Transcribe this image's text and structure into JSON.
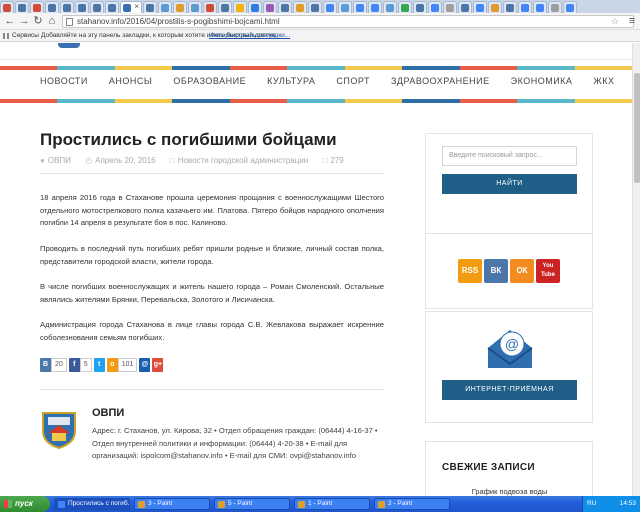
{
  "browser": {
    "tab_favicons": [
      "#d24b36",
      "#4a76a8",
      "#d24b36",
      "#4a76a8",
      "#4a76a8",
      "#4a76a8",
      "#4a76a8",
      "#4a76a8"
    ],
    "active_tab_close": "×",
    "right_tab_favicons": [
      "#4a76a8",
      "#5b9bd5",
      "#e09a2b",
      "#5b9bd5",
      "#d24b36",
      "#4a76a8",
      "#f4b400",
      "#2a7de1",
      "#9b59b6",
      "#4a76a8",
      "#e09a2b",
      "#4a76a8",
      "#4285f4",
      "#5b9bd5",
      "#4285f4",
      "#4285f4",
      "#5b9bd5",
      "#34a853",
      "#4a76a8",
      "#4285f4",
      "#9e9e9e",
      "#4a76a8",
      "#4285f4",
      "#e09a2b",
      "#4a76a8",
      "#4285f4",
      "#4285f4",
      "#9e9e9e",
      "#4285f4"
    ],
    "url": "stahanov.info/2016/04/prostilis-s-pogibshimi-bojcami.html",
    "bookmarks": {
      "services": "Сервисы",
      "hint": "Добавляйте на эту панель закладки, к которым хотите иметь быстрый доступ.",
      "import": "Импортировать закладки..."
    }
  },
  "nav": {
    "items": [
      "НОВОСТИ",
      "АНОНСЫ",
      "ОБРАЗОВАНИЕ",
      "КУЛЬТУРА",
      "СПОРТ",
      "ЗДРАВООХРАНЕНИЕ",
      "ЭКОНОМИКА",
      "ЖКХ"
    ]
  },
  "colors": {
    "stripe": [
      "#e85c4a",
      "#5bb8c9",
      "#f2c94c",
      "#2f6fa6",
      "#e85c4a",
      "#5bb8c9",
      "#f2c94c",
      "#2f6fa6",
      "#e85c4a",
      "#5bb8c9",
      "#f2c94c"
    ],
    "accent": "#1f5e86"
  },
  "article": {
    "title": "Простились с погибшими бойцами",
    "author": "ОВПИ",
    "date": "Апрель 20, 2016",
    "category": "Новости городской администрации",
    "views": "279",
    "paragraphs": [
      "18 апреля 2016 года в Стаханове прошла церемония прощания с военнослужащими Шестого отдельного мотострелкового полка казачьего им. Платова. Пятеро бойцов народного ополчения погибли 14 апреля в результате боя в пос. Калиново.",
      "Проводить в последний путь погибших ребят пришли родные и близкие, личный состав полка, представители городской власти, жители города.",
      "В числе погибших военнослужащих и житель нашего города – Роман Смоленский. Остальные являлись жителями Брянки, Перевальска, Золотого и Лисичанска.",
      "Администрация города Стаханова в лице главы города С.В. Жевлакова выражает искренние соболезнования семьям погибших."
    ],
    "share": [
      {
        "icon": "vk",
        "glyph": "В",
        "count": "20",
        "color": "#4a76a8"
      },
      {
        "icon": "facebook",
        "glyph": "f",
        "count": "5",
        "color": "#3b5998"
      },
      {
        "icon": "twitter",
        "glyph": "t",
        "count": "",
        "color": "#1da1f2"
      },
      {
        "icon": "odnoklassniki",
        "glyph": "о",
        "count": "101",
        "color": "#f39c12"
      },
      {
        "icon": "mail",
        "glyph": "@",
        "count": "",
        "color": "#1a5db0"
      },
      {
        "icon": "google-plus",
        "glyph": "g+",
        "count": "",
        "color": "#dd4b39"
      }
    ]
  },
  "author_box": {
    "name": "ОВПИ",
    "info": "Адрес: г. Стаханов, ул. Кирова, 32 • Отдел обращения граждан: (06444) 4-16-37 • Отдел внутренней политики и информации: (06444) 4-20-38 • E-mail для организаций: ispolcom@stahanov.info • E-mail для СМИ: ovpi@stahanov.info"
  },
  "sidebar": {
    "search_placeholder": "Введите поисковый запрос...",
    "search_button": "НАЙТИ",
    "social": [
      {
        "icon": "rss",
        "glyph": "RSS",
        "color": "#f39c12"
      },
      {
        "icon": "vk",
        "glyph": "ВК",
        "color": "#4a76a8"
      },
      {
        "icon": "odnoklassniki",
        "glyph": "ОК",
        "color": "#f28c1e"
      },
      {
        "icon": "youtube",
        "glyph": "You Tube",
        "color": "#cc2222"
      }
    ],
    "reception_button": "ИНТЕРНЕТ-ПРИЁМНАЯ",
    "recent_title": "СВЕЖИЕ ЗАПИСИ",
    "recent_first": "График подвоза воды"
  },
  "taskbar": {
    "start": "пуск",
    "tasks": [
      {
        "label": "Простились с погиб...",
        "active": true
      },
      {
        "label": "3 - Paint",
        "active": false
      },
      {
        "label": "5 - Paint",
        "active": false
      },
      {
        "label": "1 - Paint",
        "active": false
      },
      {
        "label": "2 - Paint",
        "active": false
      }
    ],
    "lang": "RU",
    "time": "14:53"
  }
}
